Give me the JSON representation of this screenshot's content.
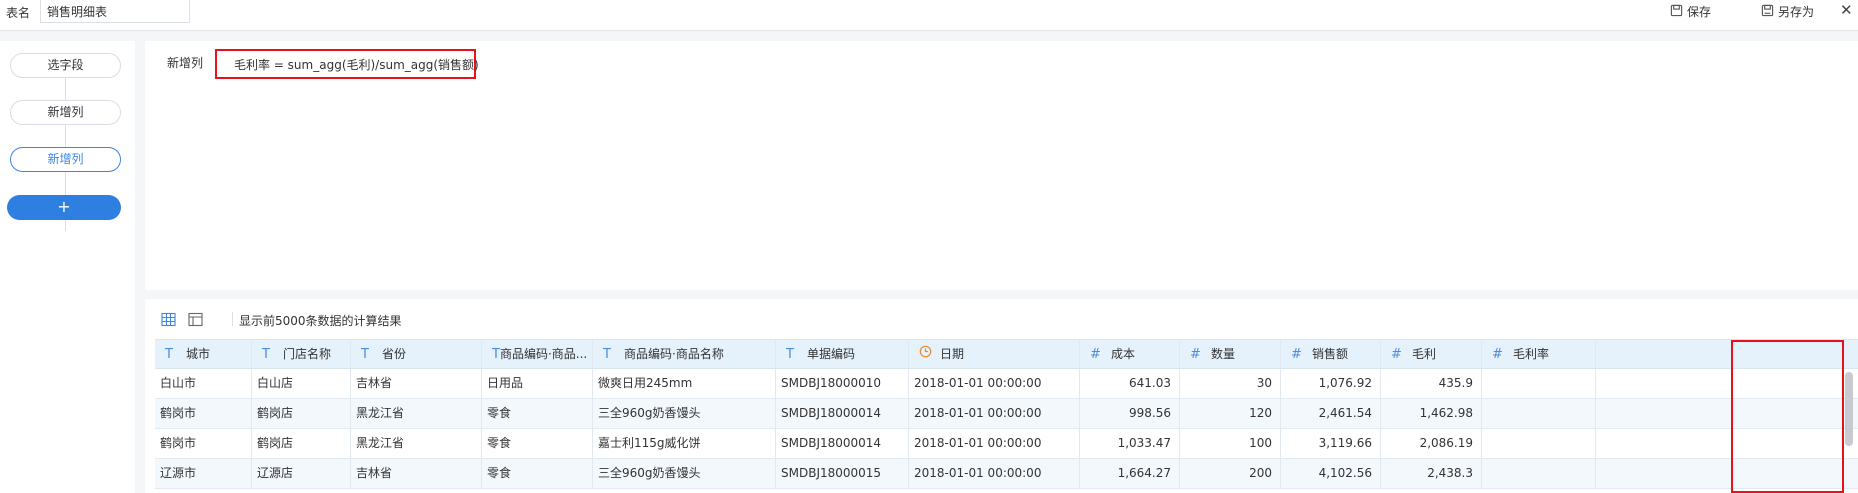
{
  "header": {
    "table_name_label": "表名",
    "table_name_value": "销售明细表",
    "save_label": "保存",
    "save_as_label": "另存为",
    "close_glyph": "✕"
  },
  "steps": {
    "items": [
      {
        "label": "选字段"
      },
      {
        "label": "新增列"
      },
      {
        "label": "新增列",
        "active": true
      }
    ],
    "add_glyph": "+"
  },
  "editor": {
    "label": "新增列",
    "formula": "毛利率 = sum_agg(毛利)/sum_agg(销售额)"
  },
  "results": {
    "note": "显示前5000条数据的计算结果",
    "columns": [
      {
        "type_icon": "T",
        "name": "城市"
      },
      {
        "type_icon": "T",
        "name": "门店名称"
      },
      {
        "type_icon": "T",
        "name": "省份"
      },
      {
        "type_icon": "T",
        "name": "商品编码·商品..."
      },
      {
        "type_icon": "T",
        "name": "商品编码·商品名称"
      },
      {
        "type_icon": "T",
        "name": "单据编码"
      },
      {
        "type_icon": "clock",
        "name": "日期"
      },
      {
        "type_icon": "#",
        "name": "成本"
      },
      {
        "type_icon": "#",
        "name": "数量"
      },
      {
        "type_icon": "#",
        "name": "销售额"
      },
      {
        "type_icon": "#",
        "name": "毛利"
      },
      {
        "type_icon": "#",
        "name": "毛利率"
      }
    ],
    "rows": [
      [
        "白山市",
        "白山店",
        "吉林省",
        "日用品",
        "微爽日用245mm",
        "SMDBJ18000010",
        "2018-01-01 00:00:00",
        "641.03",
        "30",
        "1,076.92",
        "435.9",
        ""
      ],
      [
        "鹤岗市",
        "鹤岗店",
        "黑龙江省",
        "零食",
        "三全960g奶香馒头",
        "SMDBJ18000014",
        "2018-01-01 00:00:00",
        "998.56",
        "120",
        "2,461.54",
        "1,462.98",
        ""
      ],
      [
        "鹤岗市",
        "鹤岗店",
        "黑龙江省",
        "零食",
        "嘉士利115g威化饼",
        "SMDBJ18000014",
        "2018-01-01 00:00:00",
        "1,033.47",
        "100",
        "3,119.66",
        "2,086.19",
        ""
      ],
      [
        "辽源市",
        "辽源店",
        "吉林省",
        "零食",
        "三全960g奶香馒头",
        "SMDBJ18000015",
        "2018-01-01 00:00:00",
        "1,664.27",
        "200",
        "4,102.56",
        "2,438.3",
        ""
      ]
    ]
  },
  "colors": {
    "accent": "#2f7fe0",
    "highlight": "#e8101a",
    "header_bg": "#e5f1fb"
  }
}
